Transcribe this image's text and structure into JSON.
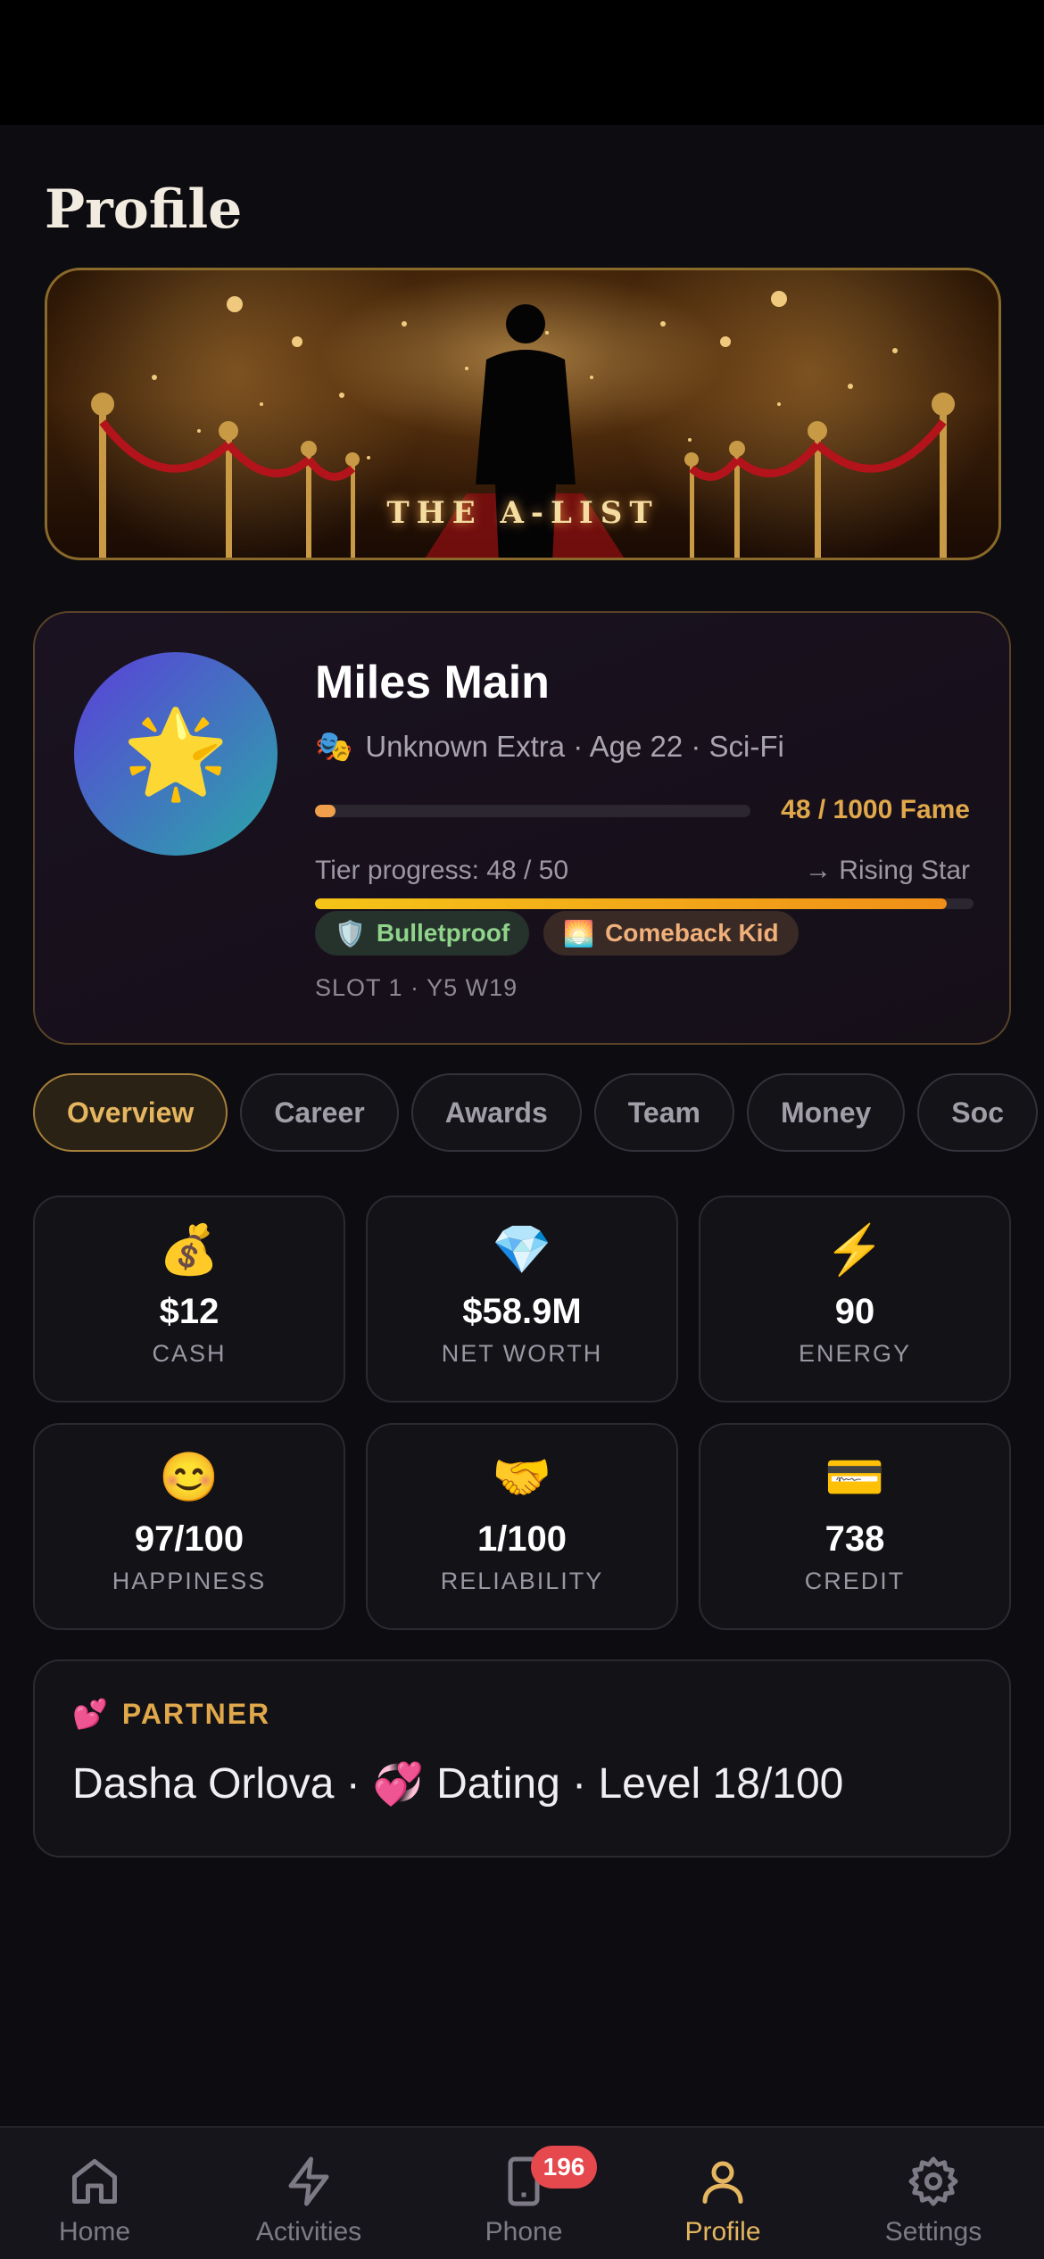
{
  "page": {
    "title": "Profile"
  },
  "banner": {
    "title": "THE A-LIST"
  },
  "profile": {
    "name": "Miles Main",
    "role_emoji": "🎭",
    "subtitle": "Unknown Extra · Age 22 · Sci-Fi",
    "avatar_emoji": "🌟",
    "fame_text": "48 / 1000 Fame",
    "fame_fraction": 0.048,
    "tier_label": "Tier progress: 48 / 50",
    "tier_next": "→ Rising Star",
    "tier_fraction": 0.96,
    "badges": [
      {
        "emoji": "🛡️",
        "label": "Bulletproof"
      },
      {
        "emoji": "🌅",
        "label": "Comeback Kid"
      }
    ],
    "slot": "SLOT 1 · Y5 W19"
  },
  "tabs": [
    {
      "label": "Overview"
    },
    {
      "label": "Career"
    },
    {
      "label": "Awards"
    },
    {
      "label": "Team"
    },
    {
      "label": "Money"
    },
    {
      "label": "Soc"
    }
  ],
  "stats": [
    {
      "emoji": "💰",
      "value": "$12",
      "label": "CASH"
    },
    {
      "emoji": "💎",
      "value": "$58.9M",
      "label": "NET WORTH"
    },
    {
      "emoji": "⚡",
      "value": "90",
      "label": "ENERGY"
    },
    {
      "emoji": "😊",
      "value": "97/100",
      "label": "HAPPINESS"
    },
    {
      "emoji": "🤝",
      "value": "1/100",
      "label": "RELIABILITY"
    },
    {
      "emoji": "💳",
      "value": "738",
      "label": "CREDIT"
    }
  ],
  "partner": {
    "emoji": "💕",
    "heading": "PARTNER",
    "name": "Dasha Orlova ·",
    "status_emoji": "💞",
    "status": "Dating · Level 18/100"
  },
  "nav": {
    "home": "Home",
    "activities": "Activities",
    "phone": "Phone",
    "phone_badge": "196",
    "profile": "Profile",
    "settings": "Settings"
  },
  "colors": {
    "accent": "#e5b560",
    "background": "#0d0c10",
    "badge_red": "#e5484d"
  }
}
